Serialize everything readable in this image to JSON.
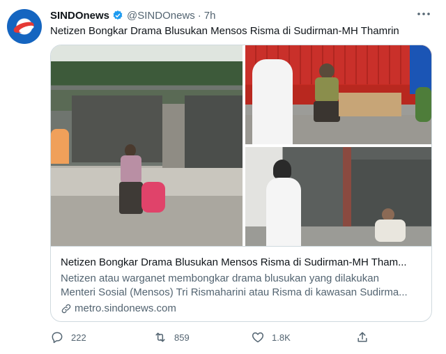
{
  "account": {
    "name": "SINDOnews",
    "handle": "@SINDOnews",
    "separator": "·",
    "time": "7h"
  },
  "tweet": {
    "text": "Netizen Bongkar Drama Blusukan Mensos Risma di Sudirman-MH Thamrin"
  },
  "card": {
    "title": "Netizen Bongkar Drama Blusukan Mensos Risma di Sudirman-MH Tham...",
    "description_line1": "Netizen atau warganet membongkar drama blusukan yang dilakukan",
    "description_line2": "Menteri Sosial (Mensos) Tri Rismaharini atau Risma di kawasan Sudirma...",
    "domain": "metro.sindonews.com"
  },
  "actions": {
    "reply_count": "222",
    "retweet_count": "859",
    "like_count": "1.8K"
  },
  "icons": {
    "verified": "verified-badge-icon",
    "more": "more-options-icon",
    "link": "link-icon",
    "reply": "reply-icon",
    "retweet": "retweet-icon",
    "like": "heart-icon",
    "share": "share-icon"
  },
  "colors": {
    "verified": "#1d9bf0",
    "secondary_text": "#536471",
    "border": "#cfd9de"
  }
}
